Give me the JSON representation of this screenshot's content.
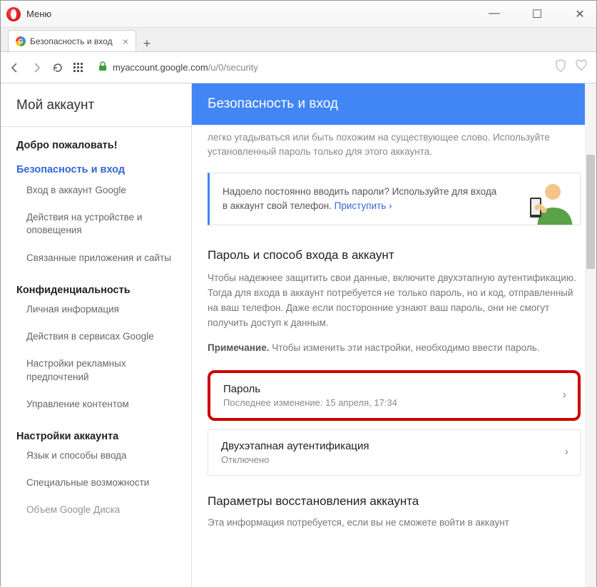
{
  "window": {
    "menu_label": "Меню"
  },
  "tab": {
    "title": "Безопасность и вход"
  },
  "address": {
    "host": "myaccount.google.com",
    "path": "/u/0/security"
  },
  "sidebar": {
    "title": "Мой аккаунт",
    "welcome": "Добро пожаловать!",
    "sections": [
      {
        "label": "Безопасность и вход",
        "active": true,
        "items": [
          "Вход в аккаунт Google",
          "Действия на устройстве и оповещения",
          "Связанные приложения и сайты"
        ]
      },
      {
        "label": "Конфиденциальность",
        "items": [
          "Личная информация",
          "Действия в сервисах Google",
          "Настройки рекламных предпочтений",
          "Управление контентом"
        ]
      },
      {
        "label": "Настройки аккаунта",
        "items": [
          "Язык и способы ввода",
          "Специальные возможности",
          "Объем Google Диска"
        ]
      }
    ]
  },
  "main": {
    "header": "Безопасность и вход",
    "tip": "легко угадываться или быть похожим на существующее слово. Используйте установленный пароль только для этого аккаунта.",
    "promo_text": "Надоело постоянно вводить пароли? Используйте для входа в аккаунт свой телефон.",
    "promo_link": "Приступить",
    "section1_title": "Пароль и способ входа в аккаунт",
    "section1_p": "Чтобы надежнее защитить свои данные, включите двухэтапную аутентификацию. Тогда для входа в аккаунт потребуется не только пароль, но и код, отправленный на ваш телефон. Даже если посторонние узнают ваш пароль, они не смогут получить доступ к данным.",
    "note_label": "Примечание.",
    "note_text": " Чтобы изменить эти настройки, необходимо ввести пароль.",
    "row1_title": "Пароль",
    "row1_sub": "Последнее изменение: 15 апреля, 17:34",
    "row2_title": "Двухэтапная аутентификация",
    "row2_sub": "Отключено",
    "section2_title": "Параметры восстановления аккаунта",
    "section2_p": "Эта информация потребуется, если вы не сможете войти в аккаунт"
  }
}
